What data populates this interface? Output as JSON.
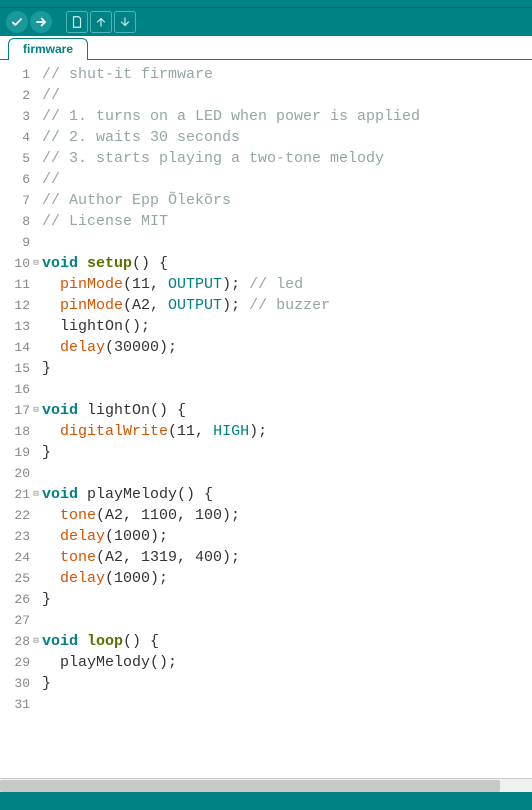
{
  "tabs": {
    "active": "firmware"
  },
  "toolbar": {
    "verify": "verify-icon",
    "upload": "upload-icon",
    "new": "new-icon",
    "open": "open-icon",
    "save": "save-icon"
  },
  "code": {
    "lines": [
      {
        "n": 1,
        "fold": "",
        "t": [
          [
            "c-comment",
            "// shut-it firmware"
          ]
        ]
      },
      {
        "n": 2,
        "fold": "",
        "t": [
          [
            "c-comment",
            "//"
          ]
        ]
      },
      {
        "n": 3,
        "fold": "",
        "t": [
          [
            "c-comment",
            "// 1. turns on a LED when power is applied"
          ]
        ]
      },
      {
        "n": 4,
        "fold": "",
        "t": [
          [
            "c-comment",
            "// 2. waits 30 seconds"
          ]
        ]
      },
      {
        "n": 5,
        "fold": "",
        "t": [
          [
            "c-comment",
            "// 3. starts playing a two-tone melody"
          ]
        ]
      },
      {
        "n": 6,
        "fold": "",
        "t": [
          [
            "c-comment",
            "//"
          ]
        ]
      },
      {
        "n": 7,
        "fold": "",
        "t": [
          [
            "c-comment",
            "// Author Epp Õlekõrs"
          ]
        ]
      },
      {
        "n": 8,
        "fold": "",
        "t": [
          [
            "c-comment",
            "// License MIT"
          ]
        ]
      },
      {
        "n": 9,
        "fold": "",
        "t": [
          [
            "c-plain",
            ""
          ]
        ]
      },
      {
        "n": 10,
        "fold": "⊟",
        "t": [
          [
            "c-keyword",
            "void"
          ],
          [
            "c-plain",
            " "
          ],
          [
            "c-funcname",
            "setup"
          ],
          [
            "c-plain",
            "() {"
          ]
        ]
      },
      {
        "n": 11,
        "fold": "",
        "t": [
          [
            "c-plain",
            "  "
          ],
          [
            "c-func",
            "pinMode"
          ],
          [
            "c-plain",
            "(11, "
          ],
          [
            "c-const",
            "OUTPUT"
          ],
          [
            "c-plain",
            "); "
          ],
          [
            "c-comment",
            "// led"
          ]
        ]
      },
      {
        "n": 12,
        "fold": "",
        "t": [
          [
            "c-plain",
            "  "
          ],
          [
            "c-func",
            "pinMode"
          ],
          [
            "c-plain",
            "(A2, "
          ],
          [
            "c-const",
            "OUTPUT"
          ],
          [
            "c-plain",
            "); "
          ],
          [
            "c-comment",
            "// buzzer"
          ]
        ]
      },
      {
        "n": 13,
        "fold": "",
        "t": [
          [
            "c-plain",
            "  lightOn();"
          ]
        ]
      },
      {
        "n": 14,
        "fold": "",
        "t": [
          [
            "c-plain",
            "  "
          ],
          [
            "c-func",
            "delay"
          ],
          [
            "c-plain",
            "(30000);"
          ]
        ]
      },
      {
        "n": 15,
        "fold": "",
        "t": [
          [
            "c-plain",
            "}"
          ]
        ]
      },
      {
        "n": 16,
        "fold": "",
        "t": [
          [
            "c-plain",
            ""
          ]
        ]
      },
      {
        "n": 17,
        "fold": "⊟",
        "t": [
          [
            "c-keyword",
            "void"
          ],
          [
            "c-plain",
            " lightOn() {"
          ]
        ]
      },
      {
        "n": 18,
        "fold": "",
        "t": [
          [
            "c-plain",
            "  "
          ],
          [
            "c-func",
            "digitalWrite"
          ],
          [
            "c-plain",
            "(11, "
          ],
          [
            "c-const",
            "HIGH"
          ],
          [
            "c-plain",
            ");"
          ]
        ]
      },
      {
        "n": 19,
        "fold": "",
        "t": [
          [
            "c-plain",
            "}"
          ]
        ]
      },
      {
        "n": 20,
        "fold": "",
        "t": [
          [
            "c-plain",
            ""
          ]
        ]
      },
      {
        "n": 21,
        "fold": "⊟",
        "t": [
          [
            "c-keyword",
            "void"
          ],
          [
            "c-plain",
            " playMelody() {"
          ]
        ]
      },
      {
        "n": 22,
        "fold": "",
        "t": [
          [
            "c-plain",
            "  "
          ],
          [
            "c-func",
            "tone"
          ],
          [
            "c-plain",
            "(A2, 1100, 100);"
          ]
        ]
      },
      {
        "n": 23,
        "fold": "",
        "t": [
          [
            "c-plain",
            "  "
          ],
          [
            "c-func",
            "delay"
          ],
          [
            "c-plain",
            "(1000);"
          ]
        ]
      },
      {
        "n": 24,
        "fold": "",
        "t": [
          [
            "c-plain",
            "  "
          ],
          [
            "c-func",
            "tone"
          ],
          [
            "c-plain",
            "(A2, 1319, 400);"
          ]
        ]
      },
      {
        "n": 25,
        "fold": "",
        "t": [
          [
            "c-plain",
            "  "
          ],
          [
            "c-func",
            "delay"
          ],
          [
            "c-plain",
            "(1000);"
          ]
        ]
      },
      {
        "n": 26,
        "fold": "",
        "t": [
          [
            "c-plain",
            "}"
          ]
        ]
      },
      {
        "n": 27,
        "fold": "",
        "t": [
          [
            "c-plain",
            ""
          ]
        ]
      },
      {
        "n": 28,
        "fold": "⊟",
        "t": [
          [
            "c-keyword",
            "void"
          ],
          [
            "c-plain",
            " "
          ],
          [
            "c-funcname",
            "loop"
          ],
          [
            "c-plain",
            "() {"
          ]
        ]
      },
      {
        "n": 29,
        "fold": "",
        "t": [
          [
            "c-plain",
            "  playMelody();"
          ]
        ]
      },
      {
        "n": 30,
        "fold": "",
        "t": [
          [
            "c-plain",
            "}"
          ]
        ]
      },
      {
        "n": 31,
        "fold": "",
        "t": [
          [
            "c-plain",
            ""
          ]
        ]
      }
    ]
  }
}
